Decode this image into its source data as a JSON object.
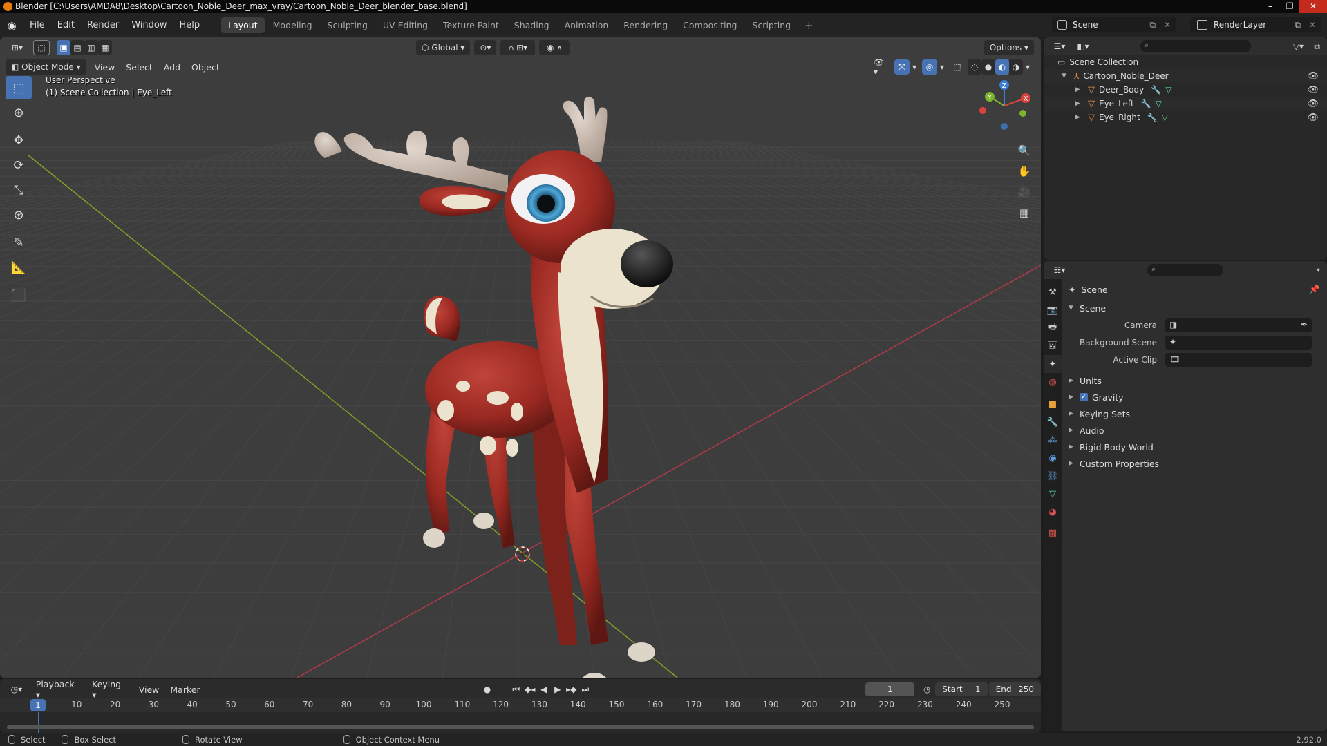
{
  "window": {
    "title": "Blender [C:\\Users\\AMDA8\\Desktop\\Cartoon_Noble_Deer_max_vray/Cartoon_Noble_Deer_blender_base.blend]",
    "controls": [
      "–",
      "❐",
      "✕"
    ]
  },
  "menu": {
    "items": [
      "File",
      "Edit",
      "Render",
      "Window",
      "Help"
    ],
    "workspaces": [
      "Layout",
      "Modeling",
      "Sculpting",
      "UV Editing",
      "Texture Paint",
      "Shading",
      "Animation",
      "Rendering",
      "Compositing",
      "Scripting"
    ],
    "active_workspace": "Layout",
    "add_workspace": "+",
    "scene": "Scene",
    "render_layer": "RenderLayer"
  },
  "viewport": {
    "mode": "Object Mode",
    "menus": [
      "View",
      "Select",
      "Add",
      "Object"
    ],
    "transform_orientation": "Global",
    "options_label": "Options",
    "perspective": "User Perspective",
    "context": "(1) Scene Collection | Eye_Left",
    "gizmo_axes": {
      "x": "X",
      "y": "Y",
      "z": "Z"
    },
    "colors": {
      "background": "#3d3d3d",
      "grid": "#4a4a4a",
      "x_axis": "#b23a48",
      "y_axis": "#7fa32a",
      "deer_body": "#9b2a22",
      "deer_cream": "#ece3cf",
      "antler": "#c8b9ae",
      "accent": "#4772b3"
    }
  },
  "tools": [
    "select-box",
    "cursor",
    "move",
    "rotate",
    "scale",
    "transform",
    "annotate",
    "measure",
    "add-cube"
  ],
  "timeline": {
    "menus": [
      "Playback",
      "Keying",
      "View",
      "Marker"
    ],
    "current_frame": "1",
    "start_label": "Start",
    "start": "1",
    "end_label": "End",
    "end": "250",
    "marker_frame": "1",
    "ticks": [
      "10",
      "20",
      "30",
      "40",
      "50",
      "60",
      "70",
      "80",
      "90",
      "100",
      "110",
      "120",
      "130",
      "140",
      "150",
      "160",
      "170",
      "180",
      "190",
      "200",
      "210",
      "220",
      "230",
      "240",
      "250"
    ]
  },
  "outliner": {
    "root": "Scene Collection",
    "items": [
      {
        "name": "Cartoon_Noble_Deer",
        "depth": 1
      },
      {
        "name": "Deer_Body",
        "depth": 2
      },
      {
        "name": "Eye_Left",
        "depth": 2
      },
      {
        "name": "Eye_Right",
        "depth": 2
      }
    ]
  },
  "properties": {
    "context_title": "Scene",
    "panel_scene": "Scene",
    "fields": [
      {
        "label": "Camera",
        "value": ""
      },
      {
        "label": "Background Scene",
        "value": ""
      },
      {
        "label": "Active Clip",
        "value": ""
      }
    ],
    "panels": [
      "Units",
      "Gravity",
      "Keying Sets",
      "Audio",
      "Rigid Body World",
      "Custom Properties"
    ],
    "gravity_checked": true
  },
  "status": {
    "select": "Select",
    "box_select": "Box Select",
    "rotate_view": "Rotate View",
    "context_menu": "Object Context Menu",
    "version": "2.92.0"
  }
}
